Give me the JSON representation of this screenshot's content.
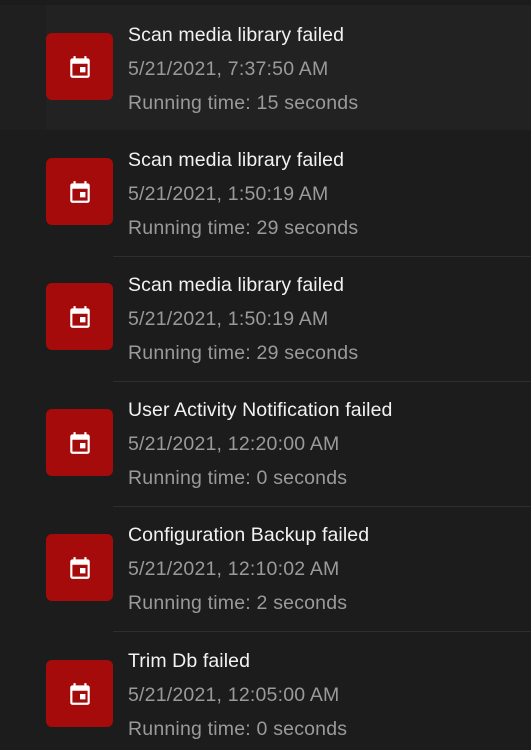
{
  "colors": {
    "background": "#1c1c1c",
    "icon_bg": "#a50b0b",
    "title_text": "#f2f2f2",
    "secondary_text": "#9a9a9a"
  },
  "activities": [
    {
      "icon": "calendar-icon",
      "title": "Scan media library failed",
      "date": "5/21/2021, 7:37:50 AM",
      "running_time": "Running time: 15 seconds"
    },
    {
      "icon": "calendar-icon",
      "title": "Scan media library failed",
      "date": "5/21/2021, 1:50:19 AM",
      "running_time": "Running time: 29 seconds"
    },
    {
      "icon": "calendar-icon",
      "title": "Scan media library failed",
      "date": "5/21/2021, 1:50:19 AM",
      "running_time": "Running time: 29 seconds"
    },
    {
      "icon": "calendar-icon",
      "title": "User Activity Notification failed",
      "date": "5/21/2021, 12:20:00 AM",
      "running_time": "Running time: 0 seconds"
    },
    {
      "icon": "calendar-icon",
      "title": "Configuration Backup failed",
      "date": "5/21/2021, 12:10:02 AM",
      "running_time": "Running time: 2 seconds"
    },
    {
      "icon": "calendar-icon",
      "title": "Trim Db failed",
      "date": "5/21/2021, 12:05:00 AM",
      "running_time": "Running time: 0 seconds"
    }
  ]
}
